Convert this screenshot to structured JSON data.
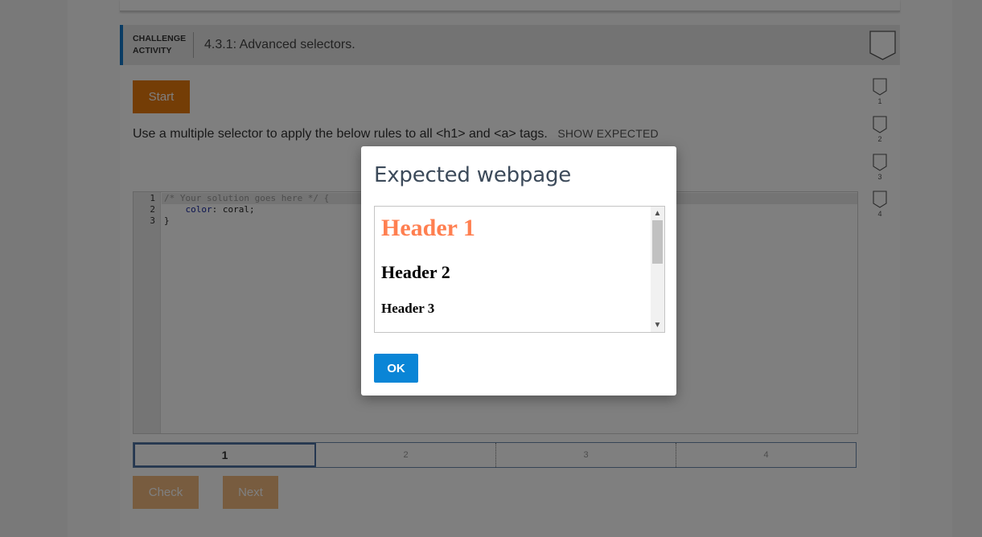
{
  "activity": {
    "label_line1": "CHALLENGE",
    "label_line2": "ACTIVITY",
    "title": "4.3.1: Advanced selectors."
  },
  "start_label": "Start",
  "instructions": "Use a multiple selector to apply the below rules to all <h1> and <a> tags.",
  "show_expected_label": "SHOW EXPECTED",
  "editor": {
    "line_numbers": [
      "1",
      "2",
      "3"
    ],
    "line1": "/* Your solution goes here */ {",
    "line2_prop": "color",
    "line2_rest": ": coral;",
    "line3": "}"
  },
  "progress": {
    "segments": [
      "1",
      "2",
      "3",
      "4"
    ],
    "current": 1
  },
  "check_label": "Check",
  "next_label": "Next",
  "levels": [
    "1",
    "2",
    "3",
    "4"
  ],
  "modal": {
    "title": "Expected webpage",
    "preview": {
      "header1": "Header 1",
      "header2": "Header 2",
      "header3": "Header 3"
    },
    "ok_label": "OK"
  },
  "colors": {
    "accent_blue": "#1478c8",
    "start_orange": "#e87a0d",
    "ok_blue": "#0a85d6",
    "coral": "#ff7f50"
  },
  "icons": {
    "level_badge": "badge-icon",
    "scroll_up": "chevron-up-icon",
    "scroll_down": "chevron-down-icon"
  }
}
